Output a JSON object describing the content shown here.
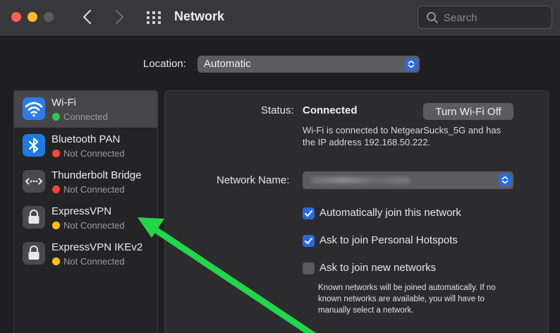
{
  "window": {
    "title": "Network",
    "search_placeholder": "Search"
  },
  "location": {
    "label": "Location:",
    "value": "Automatic"
  },
  "sidebar": {
    "items": [
      {
        "name": "Wi-Fi",
        "status": "Connected",
        "status_color": "#30c552",
        "icon": "wifi-icon",
        "selected": true
      },
      {
        "name": "Bluetooth PAN",
        "status": "Not Connected",
        "status_color": "#ff453a",
        "icon": "bluetooth-icon"
      },
      {
        "name": "Thunderbolt Bridge",
        "status": "Not Connected",
        "status_color": "#ff453a",
        "icon": "thunderbolt-bridge-icon"
      },
      {
        "name": "ExpressVPN",
        "status": "Not Connected",
        "status_color": "#ffc20e",
        "icon": "lock-icon"
      },
      {
        "name": "ExpressVPN IKEv2",
        "status": "Not Connected",
        "status_color": "#ffc20e",
        "icon": "lock-icon"
      }
    ]
  },
  "detail": {
    "status_label": "Status:",
    "status_value": "Connected",
    "turn_off_button": "Turn Wi-Fi Off",
    "status_description": "Wi-Fi is connected to NetgearSucks_5G and has the IP address 192.168.50.222.",
    "network_name_label": "Network Name:",
    "options": [
      {
        "label": "Automatically join this network",
        "checked": true
      },
      {
        "label": "Ask to join Personal Hotspots",
        "checked": true
      },
      {
        "label": "Ask to join new networks",
        "checked": false
      }
    ],
    "note": "Known networks will be joined automatically. If no known networks are available, you will have to manually select a network."
  },
  "colors": {
    "accent": "#2a6bdc",
    "annotation_arrow": "#22d64b"
  }
}
